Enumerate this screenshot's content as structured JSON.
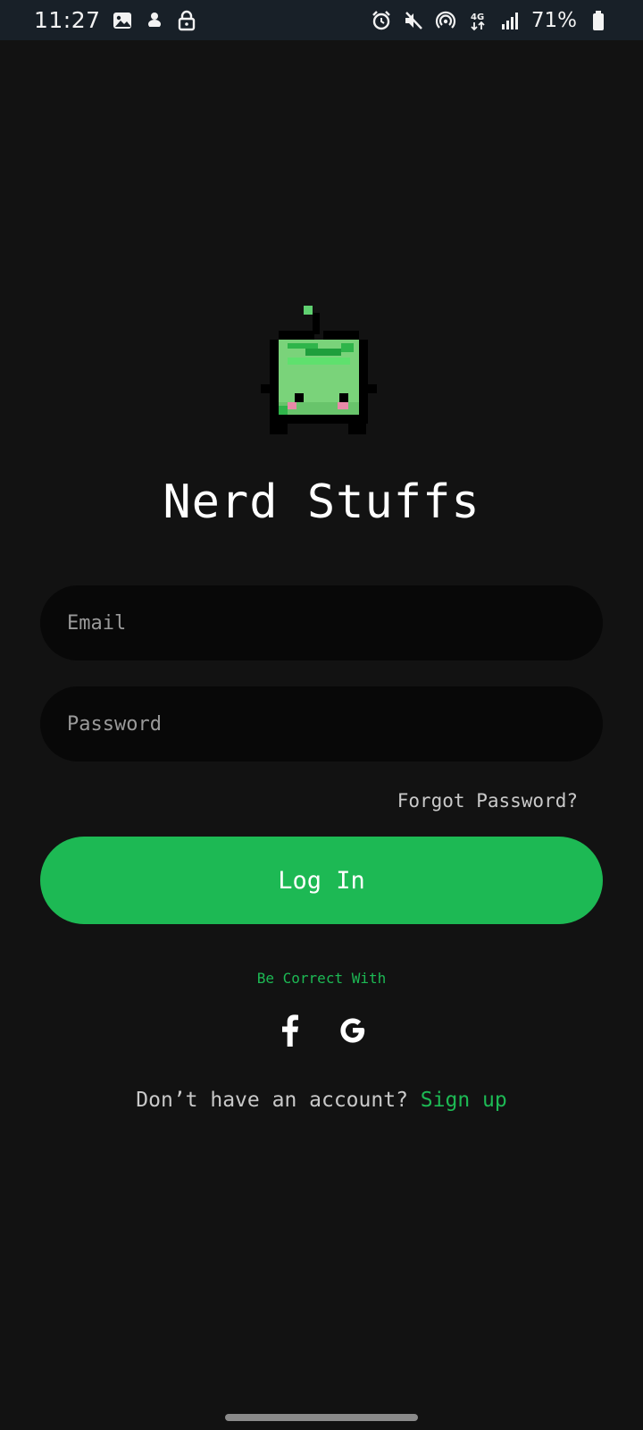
{
  "status_bar": {
    "time": "11:27",
    "battery": "71%",
    "left_icons": [
      "image-icon",
      "app-notification-icon",
      "lock-icon"
    ],
    "right_icons": [
      "alarm-icon",
      "mute-icon",
      "hotspot-icon",
      "4g-icon",
      "signal-icon",
      "battery-icon"
    ]
  },
  "app": {
    "title": "Nerd Stuffs",
    "mascot": "green-blob-mascot"
  },
  "form": {
    "email_placeholder": "Email",
    "email_value": "",
    "password_placeholder": "Password",
    "password_value": "",
    "forgot_label": "Forgot Password?",
    "login_label": "Log In"
  },
  "social": {
    "label": "Be Correct With",
    "providers": [
      "facebook-icon",
      "google-icon"
    ]
  },
  "signup": {
    "prompt": "Don’t have an account?",
    "link_label": "Sign up"
  },
  "colors": {
    "background": "#121212",
    "accent": "#1db954",
    "field_bg": "#080808",
    "status_bar_bg": "#182028"
  }
}
